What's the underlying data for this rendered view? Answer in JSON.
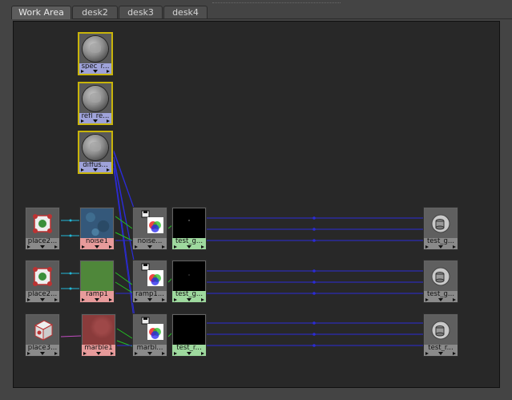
{
  "tabs": [
    {
      "label": "Work Area",
      "active": true
    },
    {
      "label": "desk2",
      "active": false
    },
    {
      "label": "desk3",
      "active": false
    },
    {
      "label": "desk4",
      "active": false
    }
  ],
  "nodes": {
    "spec": {
      "label": "spec_r..."
    },
    "refl": {
      "label": "refl_re..."
    },
    "diffuse": {
      "label": "diffus..."
    },
    "place2d_1": {
      "label": "place2..."
    },
    "noise1": {
      "label": "noise1"
    },
    "noise_tex": {
      "label": "noise..."
    },
    "test_g1": {
      "label": "test_g..."
    },
    "test_g1b": {
      "label": "test_g..."
    },
    "place2d_2": {
      "label": "place2..."
    },
    "ramp1": {
      "label": "ramp1"
    },
    "ramp1_tex": {
      "label": "ramp1..."
    },
    "test_g2": {
      "label": "test_g..."
    },
    "test_g2b": {
      "label": "test_g..."
    },
    "place3d": {
      "label": "place3..."
    },
    "marble1": {
      "label": "marble1"
    },
    "marble_tex": {
      "label": "marbl..."
    },
    "test_r": {
      "label": "test_r..."
    },
    "test_rb": {
      "label": "test_r..."
    }
  },
  "colors": {
    "shader_label": "#9fa3d9",
    "texture_label": "#e79b9b",
    "image_label": "#9ed99e",
    "selected_border": "#c8b40a",
    "wire_blue": "#2b2bd6",
    "wire_cyan": "#22b8d8",
    "wire_green": "#22c022"
  },
  "icons": [
    "sphere-swatch-icon",
    "place2d-icon",
    "place3d-icon",
    "rgb-texture-icon",
    "disk-icon",
    "cylinder-icon"
  ]
}
